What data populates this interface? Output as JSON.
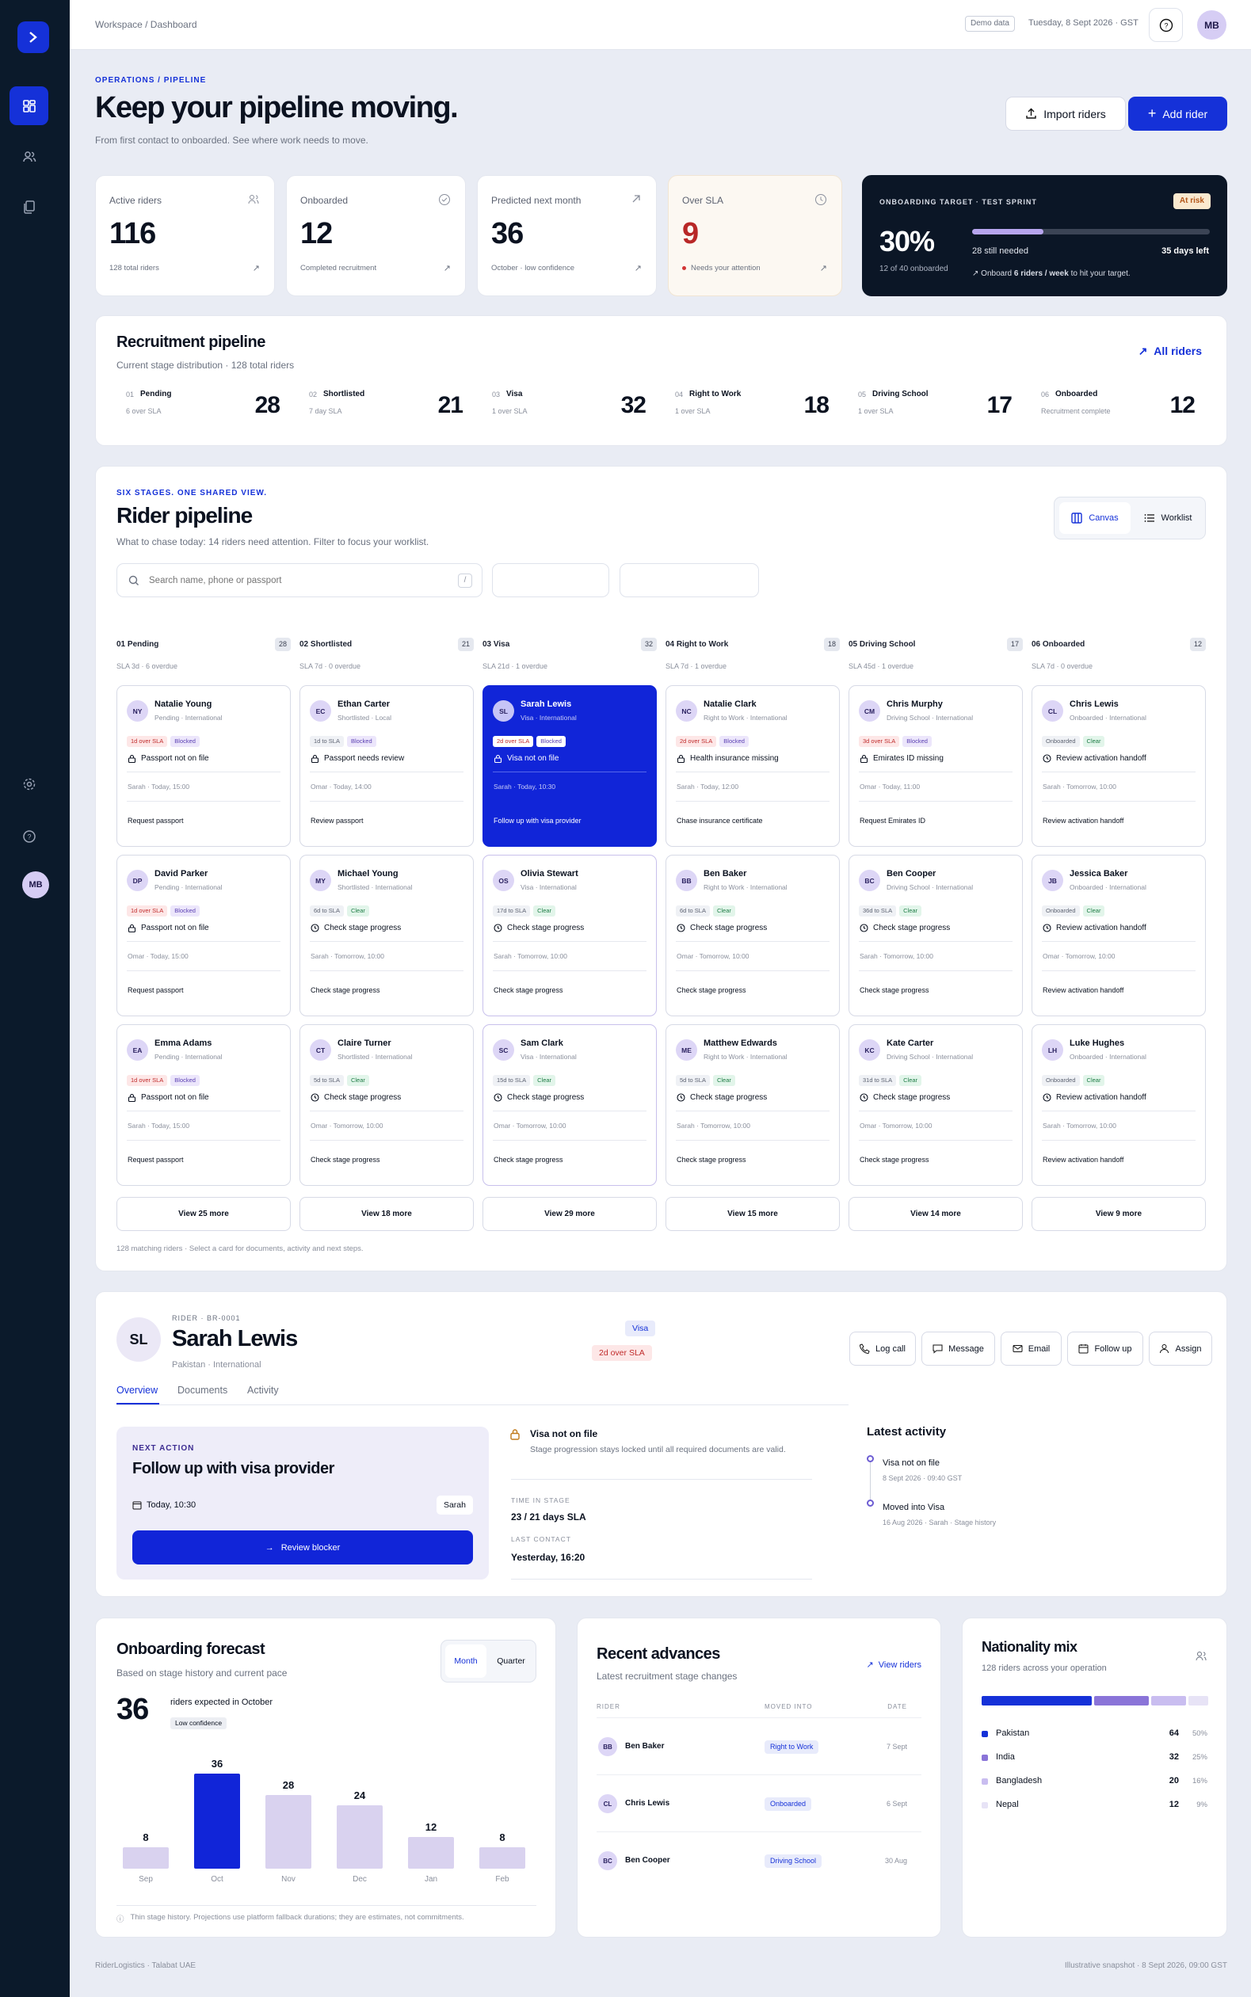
{
  "topbar": {
    "breadcrumb": "Workspace / Dashboard",
    "demo": "Demo data",
    "date": "Tuesday, 8 Sept 2026 · GST",
    "avatar": "MB"
  },
  "sidebar": {
    "avatar": "MB"
  },
  "header": {
    "eyebrow": "OPERATIONS / PIPELINE",
    "title": "Keep your pipeline moving.",
    "subtitle": "From first contact to onboarded. See where work needs to move.",
    "import_label": "Import riders",
    "add_label": "Add rider"
  },
  "stats": [
    {
      "label": "Active riders",
      "value": "116",
      "foot": "128 total riders"
    },
    {
      "label": "Onboarded",
      "value": "12",
      "foot": "Completed recruitment"
    },
    {
      "label": "Predicted next month",
      "value": "36",
      "foot": "October · low confidence"
    },
    {
      "label": "Over SLA",
      "value": "9",
      "foot": "Needs your attention"
    }
  ],
  "target": {
    "eyebrow": "ONBOARDING TARGET · TEST SPRINT",
    "badge": "At risk",
    "percent": "30%",
    "progress": 0.3,
    "onboarded": "12 of 40 onboarded",
    "needed": "28 still needed",
    "days": "35 days left",
    "hint_pre": "Onboard",
    "hint_bold": "6 riders / week",
    "hint_post": "to hit your target."
  },
  "recruitment": {
    "title": "Recruitment pipeline",
    "subtitle": "Current stage distribution · 128 total riders",
    "link": "All riders",
    "stages": [
      {
        "num": "01",
        "name": "Pending",
        "sla": "6 over SLA",
        "count": "28"
      },
      {
        "num": "02",
        "name": "Shortlisted",
        "sla": "7 day SLA",
        "count": "21"
      },
      {
        "num": "03",
        "name": "Visa",
        "sla": "1 over SLA",
        "count": "32"
      },
      {
        "num": "04",
        "name": "Right to Work",
        "sla": "1 over SLA",
        "count": "18"
      },
      {
        "num": "05",
        "name": "Driving School",
        "sla": "1 over SLA",
        "count": "17"
      },
      {
        "num": "06",
        "name": "Onboarded",
        "sla": "Recruitment complete",
        "count": "12"
      }
    ]
  },
  "pipeline": {
    "eyebrow": "SIX STAGES. ONE SHARED VIEW.",
    "title": "Rider pipeline",
    "subtitle": "What to chase today: 14 riders need attention. Filter to focus your worklist.",
    "canvas": "Canvas",
    "worklist": "Worklist",
    "search_placeholder": "Search name, phone or passport",
    "shortcut": "/",
    "footnote": "128 matching riders · Select a card for documents, activity and next steps.",
    "columns": [
      {
        "head": "01  Pending",
        "count": "28",
        "sla": "SLA 3d · 6 overdue",
        "more": "View 25 more",
        "cards": [
          {
            "initials": "NY",
            "name": "Natalie Young",
            "meta": "Pending · International",
            "tags": [
              [
                "1d over SLA",
                "red"
              ],
              [
                "Blocked",
                "pur"
              ]
            ],
            "issue": "Passport not on file",
            "icon": "lock",
            "owner": "Sarah · Today, 15:00",
            "next": "Request passport"
          },
          {
            "initials": "DP",
            "name": "David Parker",
            "meta": "Pending · International",
            "tags": [
              [
                "1d over SLA",
                "red"
              ],
              [
                "Blocked",
                "pur"
              ]
            ],
            "issue": "Passport not on file",
            "icon": "lock",
            "owner": "Omar · Today, 15:00",
            "next": "Request passport"
          },
          {
            "initials": "EA",
            "name": "Emma Adams",
            "meta": "Pending · International",
            "tags": [
              [
                "1d over SLA",
                "red"
              ],
              [
                "Blocked",
                "pur"
              ]
            ],
            "issue": "Passport not on file",
            "icon": "lock",
            "owner": "Sarah · Today, 15:00",
            "next": "Request passport"
          }
        ]
      },
      {
        "head": "02  Shortlisted",
        "count": "21",
        "sla": "SLA 7d · 0 overdue",
        "more": "View 18 more",
        "cards": [
          {
            "initials": "EC",
            "name": "Ethan Carter",
            "meta": "Shortlisted · Local",
            "tags": [
              [
                "1d to SLA",
                "grey"
              ],
              [
                "Blocked",
                "pur"
              ]
            ],
            "issue": "Passport needs review",
            "icon": "lock",
            "owner": "Omar · Today, 14:00",
            "next": "Review passport"
          },
          {
            "initials": "MY",
            "name": "Michael Young",
            "meta": "Shortlisted · International",
            "tags": [
              [
                "6d to SLA",
                "grey"
              ],
              [
                "Clear",
                "grn"
              ]
            ],
            "issue": "Check stage progress",
            "icon": "clock",
            "owner": "Sarah · Tomorrow, 10:00",
            "next": "Check stage progress"
          },
          {
            "initials": "CT",
            "name": "Claire Turner",
            "meta": "Shortlisted · International",
            "tags": [
              [
                "5d to SLA",
                "grey"
              ],
              [
                "Clear",
                "grn"
              ]
            ],
            "issue": "Check stage progress",
            "icon": "clock",
            "owner": "Omar · Tomorrow, 10:00",
            "next": "Check stage progress"
          }
        ]
      },
      {
        "head": "03  Visa",
        "count": "32",
        "sla": "SLA 21d · 1 overdue",
        "more": "View 29 more",
        "cards": [
          {
            "initials": "SL",
            "name": "Sarah Lewis",
            "meta": "Visa · International",
            "tags": [
              [
                "2d over SLA",
                "red"
              ],
              [
                "Blocked",
                "pur"
              ]
            ],
            "issue": "Visa not on file",
            "icon": "lock",
            "owner": "Sarah · Today, 10:30",
            "next": "Follow up with visa provider",
            "selected": true
          },
          {
            "initials": "OS",
            "name": "Olivia Stewart",
            "meta": "Visa · International",
            "tags": [
              [
                "17d to SLA",
                "grey"
              ],
              [
                "Clear",
                "grn"
              ]
            ],
            "issue": "Check stage progress",
            "icon": "clock",
            "owner": "Sarah · Tomorrow, 10:00",
            "next": "Check stage progress"
          },
          {
            "initials": "SC",
            "name": "Sam Clark",
            "meta": "Visa · International",
            "tags": [
              [
                "15d to SLA",
                "grey"
              ],
              [
                "Clear",
                "grn"
              ]
            ],
            "issue": "Check stage progress",
            "icon": "clock",
            "owner": "Omar · Tomorrow, 10:00",
            "next": "Check stage progress"
          }
        ]
      },
      {
        "head": "04  Right to Work",
        "count": "18",
        "sla": "SLA 7d · 1 overdue",
        "more": "View 15 more",
        "cards": [
          {
            "initials": "NC",
            "name": "Natalie Clark",
            "meta": "Right to Work · International",
            "tags": [
              [
                "2d over SLA",
                "red"
              ],
              [
                "Blocked",
                "pur"
              ]
            ],
            "issue": "Health insurance missing",
            "icon": "lock",
            "owner": "Sarah · Today, 12:00",
            "next": "Chase insurance certificate"
          },
          {
            "initials": "BB",
            "name": "Ben Baker",
            "meta": "Right to Work · International",
            "tags": [
              [
                "6d to SLA",
                "grey"
              ],
              [
                "Clear",
                "grn"
              ]
            ],
            "issue": "Check stage progress",
            "icon": "clock",
            "owner": "Omar · Tomorrow, 10:00",
            "next": "Check stage progress"
          },
          {
            "initials": "ME",
            "name": "Matthew Edwards",
            "meta": "Right to Work · International",
            "tags": [
              [
                "5d to SLA",
                "grey"
              ],
              [
                "Clear",
                "grn"
              ]
            ],
            "issue": "Check stage progress",
            "icon": "clock",
            "owner": "Sarah · Tomorrow, 10:00",
            "next": "Check stage progress"
          }
        ]
      },
      {
        "head": "05  Driving School",
        "count": "17",
        "sla": "SLA 45d · 1 overdue",
        "more": "View 14 more",
        "cards": [
          {
            "initials": "CM",
            "name": "Chris Murphy",
            "meta": "Driving School · International",
            "tags": [
              [
                "3d over SLA",
                "red"
              ],
              [
                "Blocked",
                "pur"
              ]
            ],
            "issue": "Emirates ID missing",
            "icon": "lock",
            "owner": "Omar · Today, 11:00",
            "next": "Request Emirates ID"
          },
          {
            "initials": "BC",
            "name": "Ben Cooper",
            "meta": "Driving School · International",
            "tags": [
              [
                "36d to SLA",
                "grey"
              ],
              [
                "Clear",
                "grn"
              ]
            ],
            "issue": "Check stage progress",
            "icon": "clock",
            "owner": "Sarah · Tomorrow, 10:00",
            "next": "Check stage progress"
          },
          {
            "initials": "KC",
            "name": "Kate Carter",
            "meta": "Driving School · International",
            "tags": [
              [
                "31d to SLA",
                "grey"
              ],
              [
                "Clear",
                "grn"
              ]
            ],
            "issue": "Check stage progress",
            "icon": "clock",
            "owner": "Omar · Tomorrow, 10:00",
            "next": "Check stage progress"
          }
        ]
      },
      {
        "head": "06  Onboarded",
        "count": "12",
        "sla": "SLA 7d · 0 overdue",
        "more": "View 9 more",
        "cards": [
          {
            "initials": "CL",
            "name": "Chris Lewis",
            "meta": "Onboarded · International",
            "tags": [
              [
                "Onboarded",
                "grey"
              ],
              [
                "Clear",
                "grn"
              ]
            ],
            "issue": "Review activation handoff",
            "icon": "clock",
            "owner": "Sarah · Tomorrow, 10:00",
            "next": "Review activation handoff"
          },
          {
            "initials": "JB",
            "name": "Jessica Baker",
            "meta": "Onboarded · International",
            "tags": [
              [
                "Onboarded",
                "grey"
              ],
              [
                "Clear",
                "grn"
              ]
            ],
            "issue": "Review activation handoff",
            "icon": "clock",
            "owner": "Omar · Tomorrow, 10:00",
            "next": "Review activation handoff"
          },
          {
            "initials": "LH",
            "name": "Luke Hughes",
            "meta": "Onboarded · International",
            "tags": [
              [
                "Onboarded",
                "grey"
              ],
              [
                "Clear",
                "grn"
              ]
            ],
            "issue": "Review activation handoff",
            "icon": "clock",
            "owner": "Sarah · Tomorrow, 10:00",
            "next": "Review activation handoff"
          }
        ]
      }
    ]
  },
  "detail": {
    "eyebrow": "RIDER · BR-0001",
    "initials": "SL",
    "name": "Sarah Lewis",
    "origin": "Pakistan · International",
    "stage_badge": "Visa",
    "sla_badge": "2d over SLA",
    "actions": [
      "Log call",
      "Message",
      "Email",
      "Follow up",
      "Assign"
    ],
    "tabs": [
      "Overview",
      "Documents",
      "Activity"
    ],
    "next_eyebrow": "NEXT ACTION",
    "next_title": "Follow up with visa provider",
    "next_due": "Today, 10:30",
    "next_owner": "Sarah",
    "next_btn": "Review blocker",
    "blocker_title": "Visa not on file",
    "blocker_desc": "Stage progression stays locked until all required documents are valid.",
    "time_label": "TIME IN STAGE",
    "time_value": "23 / 21 days SLA",
    "contact_label": "LAST CONTACT",
    "contact_value": "Yesterday, 16:20",
    "activity_title": "Latest activity",
    "activity": [
      {
        "title": "Visa not on file",
        "meta": "8 Sept 2026 · 09:40 GST"
      },
      {
        "title": "Moved into Visa",
        "meta": "16 Aug 2026 · Sarah · Stage history"
      }
    ]
  },
  "forecast": {
    "title": "Onboarding forecast",
    "subtitle": "Based on stage history and current pace",
    "seg": [
      "Month",
      "Quarter"
    ],
    "big": "36",
    "big_label": "riders expected in October",
    "conf": "Low confidence",
    "note": "Thin stage history. Projections use platform fallback durations; they are estimates, not commitments.",
    "chart_data": {
      "type": "bar",
      "categories": [
        "Sep",
        "Oct",
        "Nov",
        "Dec",
        "Jan",
        "Feb"
      ],
      "values": [
        8,
        36,
        28,
        24,
        12,
        8
      ],
      "highlight": "Oct",
      "ylim": [
        0,
        36
      ]
    }
  },
  "advances": {
    "title": "Recent advances",
    "subtitle": "Latest recruitment stage changes",
    "link": "View riders",
    "cols": [
      "RIDER",
      "MOVED INTO",
      "DATE"
    ],
    "rows": [
      {
        "initials": "BB",
        "name": "Ben Baker",
        "stage": "Right to Work",
        "date": "7 Sept"
      },
      {
        "initials": "CL",
        "name": "Chris Lewis",
        "stage": "Onboarded",
        "date": "6 Sept"
      },
      {
        "initials": "BC",
        "name": "Ben Cooper",
        "stage": "Driving School",
        "date": "30 Aug"
      }
    ]
  },
  "nationality": {
    "title": "Nationality mix",
    "subtitle": "128 riders across your operation",
    "items": [
      {
        "name": "Pakistan",
        "count": "64",
        "pct": "50%",
        "share": 0.5,
        "color": "#1531d8"
      },
      {
        "name": "India",
        "count": "32",
        "pct": "25%",
        "share": 0.25,
        "color": "#8a74d8"
      },
      {
        "name": "Bangladesh",
        "count": "20",
        "pct": "16%",
        "share": 0.16,
        "color": "#c9bdf0"
      },
      {
        "name": "Nepal",
        "count": "12",
        "pct": "9%",
        "share": 0.09,
        "color": "#e7e3f6"
      }
    ]
  },
  "footer": {
    "left": "RiderLogistics · Talabat UAE",
    "right": "Illustrative snapshot · 8 Sept 2026, 09:00 GST"
  }
}
